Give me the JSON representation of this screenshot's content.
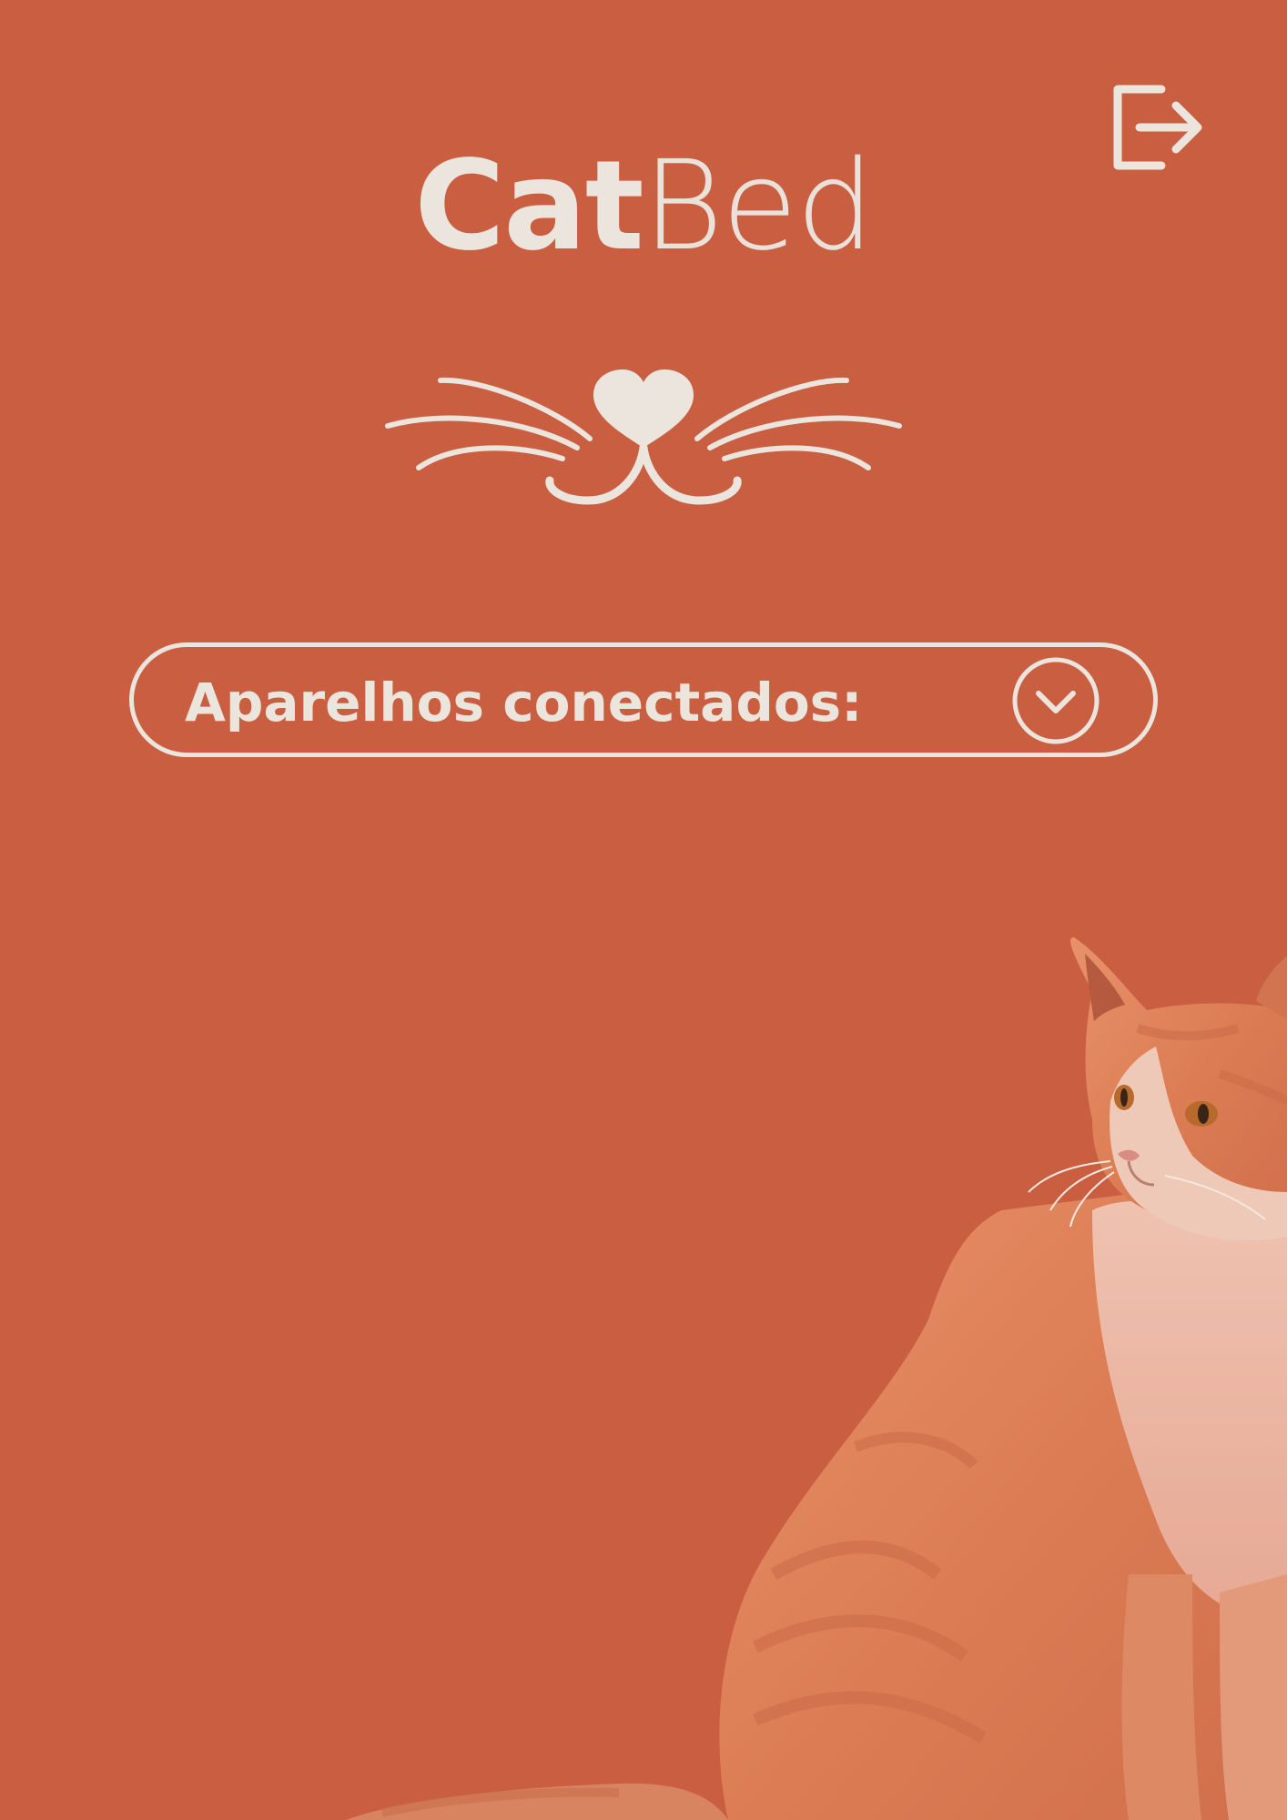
{
  "app": {
    "title_bold": "Cat",
    "title_light": "Bed"
  },
  "header": {
    "logout_icon": "logout-icon"
  },
  "logo": {
    "icon": "cat-whiskers-heart-nose-icon"
  },
  "devices": {
    "label": "Aparelhos conectados:",
    "toggle_icon": "chevron-down-icon"
  },
  "illustration": {
    "subject": "cat-photo"
  },
  "colors": {
    "background": "#c95e40",
    "foreground": "#ebe5de"
  }
}
